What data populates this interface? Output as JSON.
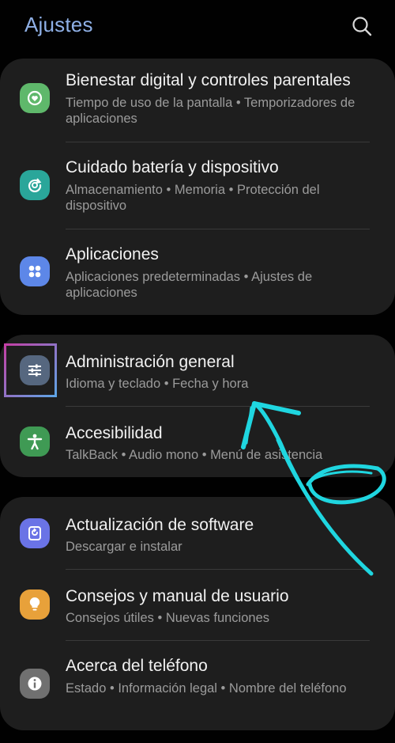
{
  "header": {
    "title": "Ajustes",
    "search_icon": "search-icon"
  },
  "groups": [
    {
      "items": [
        {
          "title": "Bienestar digital y controles parentales",
          "subtitle": "Tiempo de uso de la pantalla  •  Temporizadores de aplicaciones",
          "icon": "digital-wellbeing-icon",
          "color": "#5fb86b"
        },
        {
          "title": "Cuidado batería y dispositivo",
          "subtitle": "Almacenamiento  •  Memoria  •  Protección del dispositivo",
          "icon": "device-care-icon",
          "color": "#2aa69a"
        },
        {
          "title": "Aplicaciones",
          "subtitle": "Aplicaciones predeterminadas  •  Ajustes de aplicaciones",
          "icon": "apps-icon",
          "color": "#5d87e8"
        }
      ]
    },
    {
      "items": [
        {
          "title": "Administración general",
          "subtitle": "Idioma y teclado  •  Fecha y hora",
          "icon": "general-management-icon",
          "color": "#56677f"
        },
        {
          "title": "Accesibilidad",
          "subtitle": "TalkBack  •  Audio mono  •  Menú de asistencia",
          "icon": "accessibility-icon",
          "color": "#3f9a54"
        }
      ]
    },
    {
      "items": [
        {
          "title": "Actualización de software",
          "subtitle": "Descargar e instalar",
          "icon": "software-update-icon",
          "color": "#6a73e6"
        },
        {
          "title": "Consejos y manual de usuario",
          "subtitle": "Consejos útiles  •  Nuevas funciones",
          "icon": "tips-icon",
          "color": "#e8a13a"
        },
        {
          "title": "Acerca del teléfono",
          "subtitle": "Estado  •  Información legal  •  Nombre del teléfono",
          "icon": "about-phone-icon",
          "color": "#707070"
        }
      ]
    }
  ],
  "colors": {
    "background": "#010101",
    "card": "#1e1e1e",
    "title_accent": "#8fb0e6",
    "annotation": "#1fd6e0",
    "highlight_start": "#c43fa5",
    "highlight_end": "#5ea5e6"
  }
}
